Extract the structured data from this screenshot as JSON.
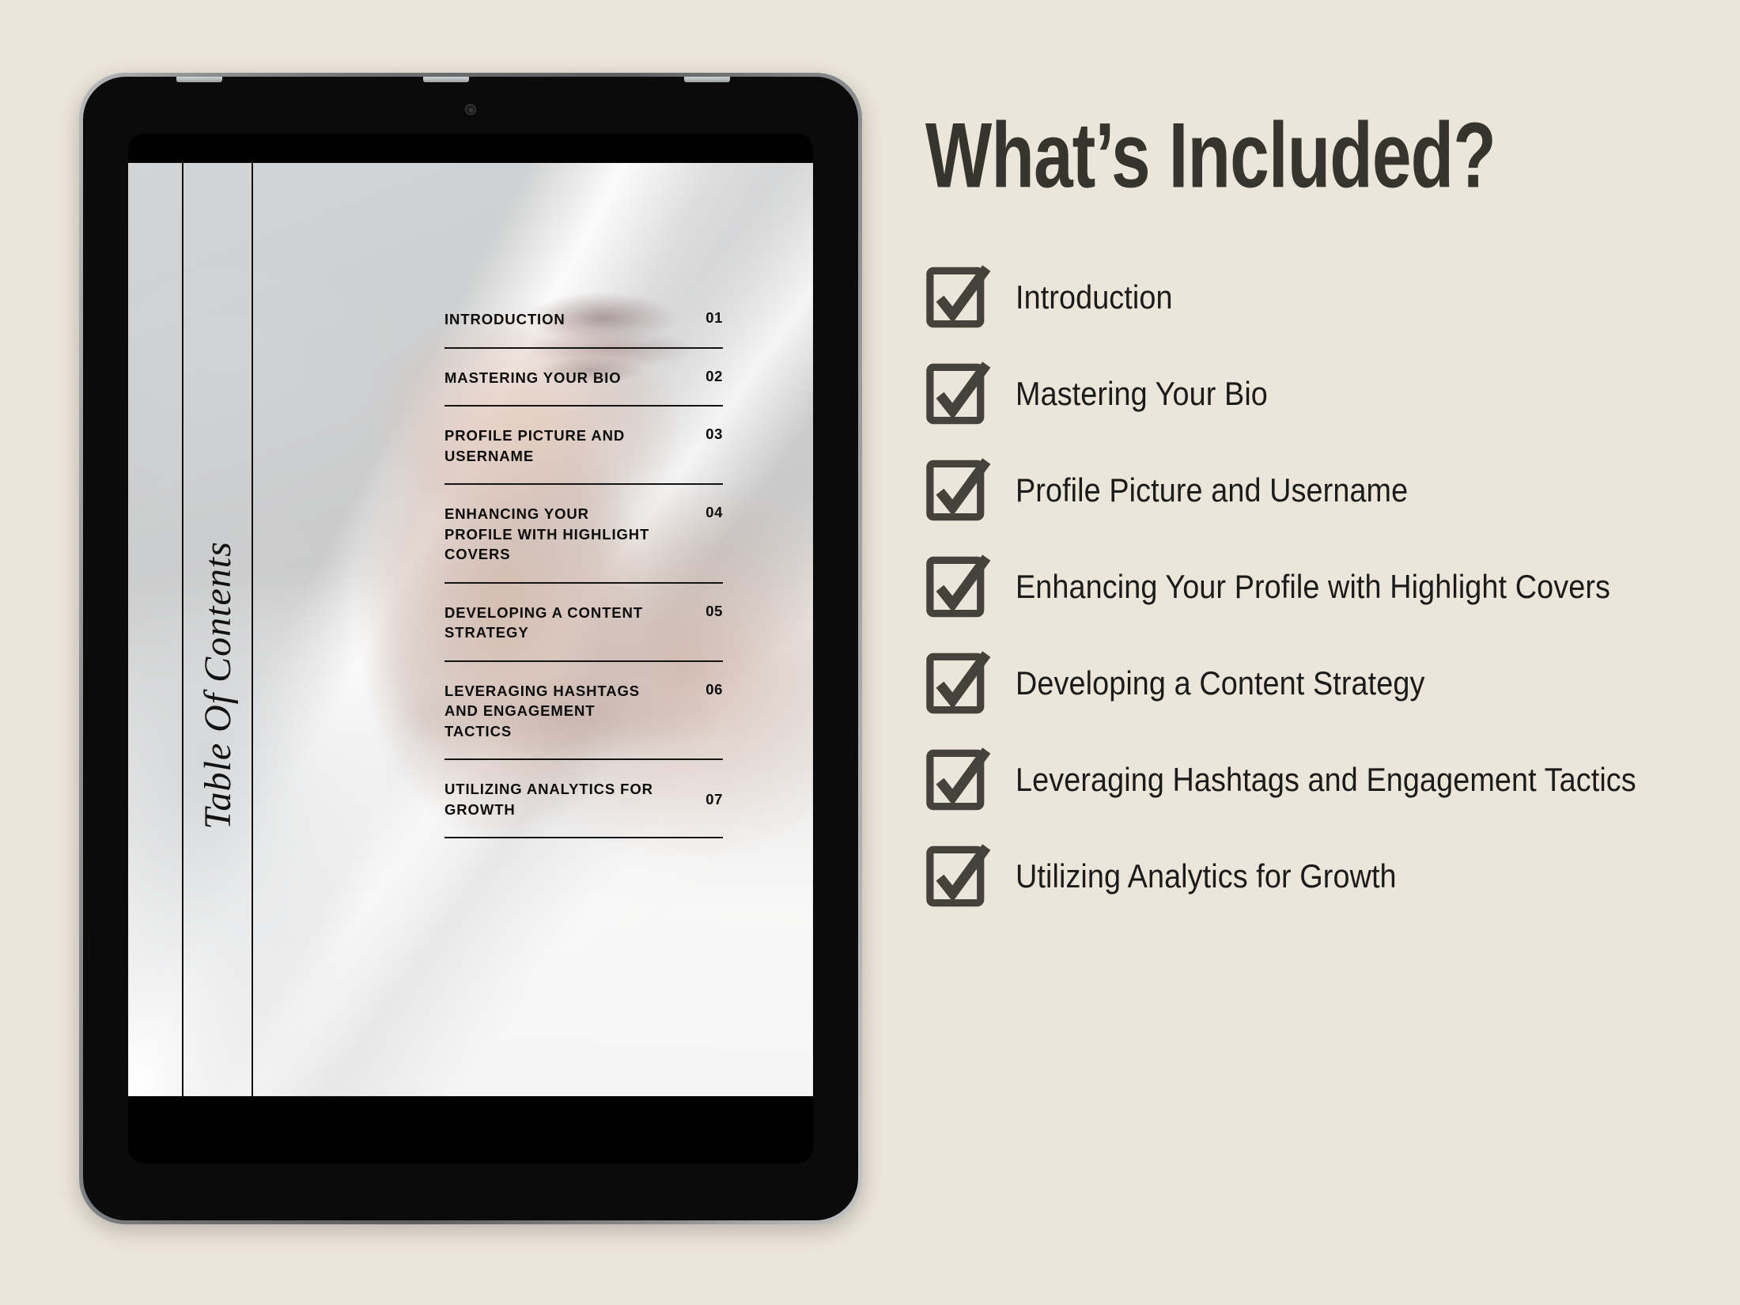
{
  "background_color": "#ece5d9",
  "accent_dark": "#35352e",
  "ink": "#0c0c0c",
  "device": {
    "type": "tablet-mockup",
    "screen_page": {
      "vertical_title": "Table Of Contents",
      "toc": [
        {
          "title": "INTRODUCTION",
          "page": "01"
        },
        {
          "title": "MASTERING YOUR BIO",
          "page": "02"
        },
        {
          "title": "PROFILE PICTURE AND USERNAME",
          "page": "03"
        },
        {
          "title": "ENHANCING YOUR PROFILE WITH HIGHLIGHT COVERS",
          "page": "04"
        },
        {
          "title": "DEVELOPING A CONTENT STRATEGY",
          "page": "05"
        },
        {
          "title": "LEVERAGING HASHTAGS AND ENGAGEMENT TACTICS",
          "page": "06"
        },
        {
          "title": "UTILIZING ANALYTICS FOR GROWTH",
          "page": "07"
        }
      ]
    }
  },
  "panel": {
    "headline": "What’s Included?",
    "checklist": [
      {
        "label": "Introduction",
        "icon": "checkbox-checked-icon",
        "checked": true
      },
      {
        "label": "Mastering Your Bio",
        "icon": "checkbox-checked-icon",
        "checked": true
      },
      {
        "label": "Profile Picture and Username",
        "icon": "checkbox-checked-icon",
        "checked": true
      },
      {
        "label": "Enhancing Your Profile with Highlight Covers",
        "icon": "checkbox-checked-icon",
        "checked": true
      },
      {
        "label": "Developing a Content Strategy",
        "icon": "checkbox-checked-icon",
        "checked": true
      },
      {
        "label": "Leveraging Hashtags and Engagement Tactics",
        "icon": "checkbox-checked-icon",
        "checked": true
      },
      {
        "label": "Utilizing Analytics for Growth",
        "icon": "checkbox-checked-icon",
        "checked": true
      }
    ]
  }
}
